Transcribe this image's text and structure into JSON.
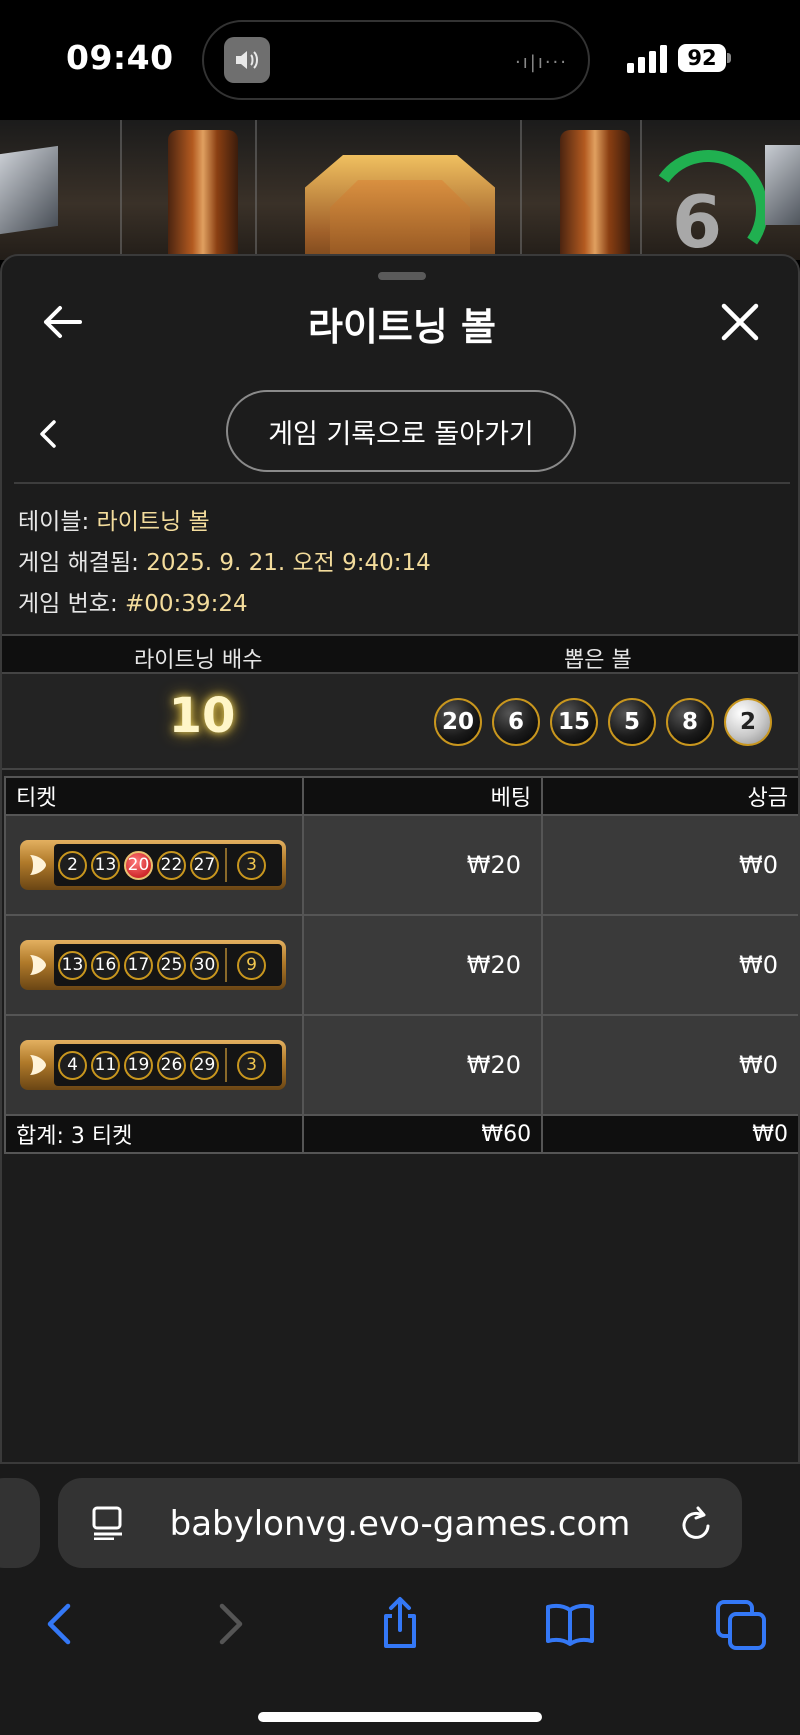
{
  "status_bar": {
    "time": "09:40",
    "battery": "92"
  },
  "game": {
    "timer": "6"
  },
  "header": {
    "title": "라이트닝 볼"
  },
  "history_button": {
    "label": "게임 기록으로 돌아가기"
  },
  "info": {
    "table_label": "테이블:",
    "table_value": "라이트닝 볼",
    "resolved_label": "게임 해결됨:",
    "resolved_value": "2025. 9. 21. 오전 9:40:14",
    "game_no_label": "게임 번호:",
    "game_no_value": "#00:39:24"
  },
  "result": {
    "multiplier_header": "라이트닝 배수",
    "balls_header": "뽑은 볼",
    "multiplier": "10",
    "drawn_balls": [
      "20",
      "6",
      "15",
      "5",
      "8",
      "2"
    ]
  },
  "tickets_table": {
    "headers": {
      "ticket": "티켓",
      "bet": "베팅",
      "prize": "상금"
    },
    "rows": [
      {
        "numbers": [
          "2",
          "13",
          "20",
          "22",
          "27"
        ],
        "hit": "20",
        "bonus": "3",
        "bet": "₩20",
        "prize": "₩0"
      },
      {
        "numbers": [
          "13",
          "16",
          "17",
          "25",
          "30"
        ],
        "hit": "",
        "bonus": "9",
        "bet": "₩20",
        "prize": "₩0"
      },
      {
        "numbers": [
          "4",
          "11",
          "19",
          "26",
          "29"
        ],
        "hit": "",
        "bonus": "3",
        "bet": "₩20",
        "prize": "₩0"
      }
    ],
    "total": {
      "label": "합계: 3 티켓",
      "bet": "₩60",
      "prize": "₩0"
    }
  },
  "browser": {
    "url": "babylonvg.evo-games.com"
  },
  "colors": {
    "accent_gold": "#c8961e",
    "value_text": "#f3dc9c",
    "ios_blue": "#3478f6",
    "timer_green": "#20b050"
  }
}
